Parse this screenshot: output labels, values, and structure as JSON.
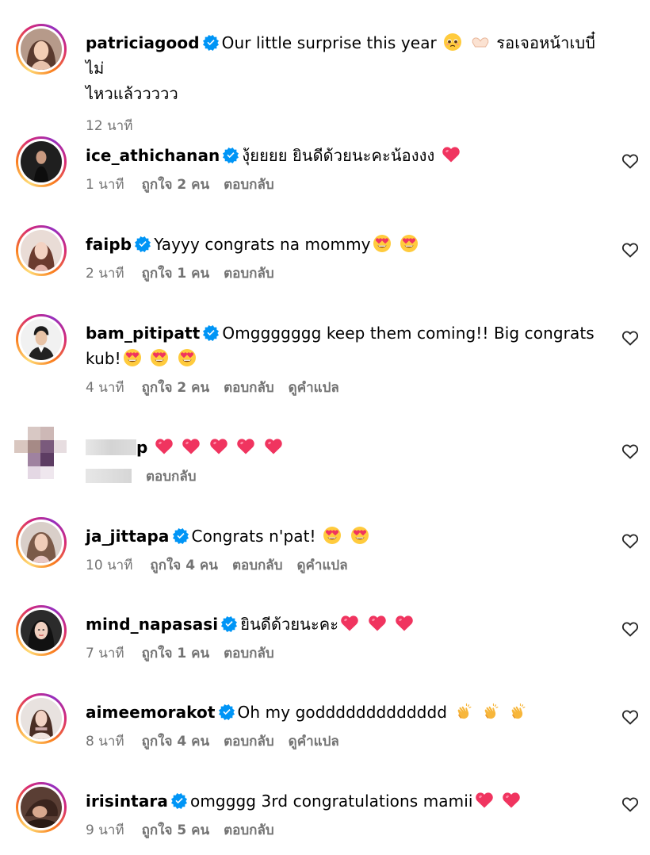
{
  "post": {
    "username": "patriciagood",
    "caption": "Our little surprise this year",
    "caption_tail_line1": "รอเจอหน้าเบบี๋ไม่",
    "caption_line2": "ไหวแล้ววววว",
    "time": "12 นาที"
  },
  "labels": {
    "reply": "ตอบกลับ",
    "see_translation": "ดูคำแปล"
  },
  "comments": [
    {
      "username": "ice_athichanan",
      "text": "งุ้ยยยย ยินดีด้วยนะคะน้องงง",
      "time": "1 นาที",
      "likes": "ถูกใจ 2 คน"
    },
    {
      "username": "faipb",
      "text": "Yayyy congrats na mommy",
      "time": "2 นาที",
      "likes": "ถูกใจ 1 คน"
    },
    {
      "username": "bam_pitipatt",
      "text": "Omggggggg keep them coming!! Big congrats",
      "text_line2": "kub!",
      "time": "4 นาที",
      "likes": "ถูกใจ 2 คน"
    },
    {
      "username": "p",
      "text": "",
      "time": ""
    },
    {
      "username": "ja_jittapa",
      "text": "Congrats n'pat!",
      "time": "10 นาที",
      "likes": "ถูกใจ 4 คน"
    },
    {
      "username": "mind_napasasi",
      "text": "ยินดีด้วยนะคะ",
      "time": "7 นาที",
      "likes": "ถูกใจ 1 คน"
    },
    {
      "username": "aimeemorakot",
      "text": "Oh my goddddddddddddd",
      "time": "8 นาที",
      "likes": "ถูกใจ 4 คน"
    },
    {
      "username": "irisintara",
      "text": "omgggg 3rd congratulations mamii",
      "time": "9 นาที",
      "likes": "ถูกใจ 5 คน"
    }
  ],
  "colors": {
    "verified": "#0095f6",
    "meta_text": "#737373",
    "heart_emoji": "#f0345f"
  },
  "icons": [
    "verified-badge-icon",
    "heart-outline-icon",
    "red-heart-emoji",
    "heart-eyes-emoji",
    "clapping-hands-emoji",
    "pleading-face-emoji",
    "heart-hands-emoji"
  ]
}
